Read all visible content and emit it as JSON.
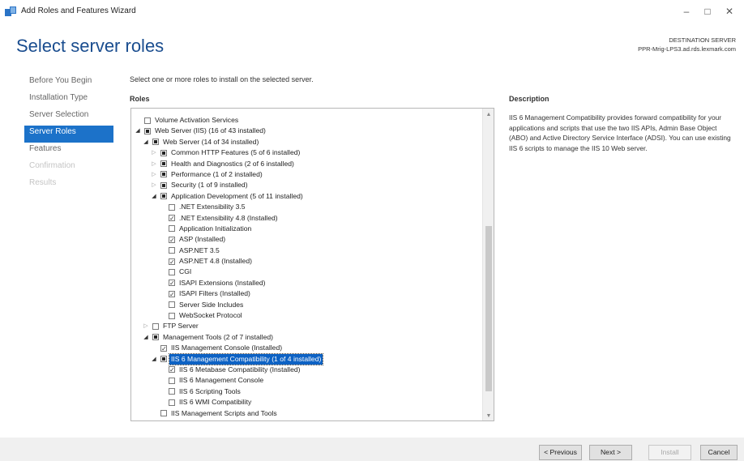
{
  "window": {
    "title": "Add Roles and Features Wizard",
    "minimize": "–",
    "maximize": "□",
    "close": "✕"
  },
  "header": {
    "title": "Select server roles",
    "destination_label": "DESTINATION SERVER",
    "destination_server": "PPR-Mrig-LPS3.ad.rds.lexmark.com"
  },
  "nav": {
    "items": [
      {
        "label": "Before You Begin",
        "state": "normal"
      },
      {
        "label": "Installation Type",
        "state": "normal"
      },
      {
        "label": "Server Selection",
        "state": "normal"
      },
      {
        "label": "Server Roles",
        "state": "active"
      },
      {
        "label": "Features",
        "state": "normal"
      },
      {
        "label": "Confirmation",
        "state": "disabled"
      },
      {
        "label": "Results",
        "state": "disabled"
      }
    ]
  },
  "main": {
    "instruction": "Select one or more roles to install on the selected server.",
    "roles_heading": "Roles",
    "roles": [
      {
        "label": "Volume Activation Services",
        "level": 0,
        "expander": "none",
        "check": "unchecked"
      },
      {
        "label": "Web Server (IIS) (16 of 43 installed)",
        "level": 0,
        "expander": "expanded",
        "check": "partial"
      },
      {
        "label": "Web Server (14 of 34 installed)",
        "level": 1,
        "expander": "expanded",
        "check": "partial"
      },
      {
        "label": "Common HTTP Features (5 of 6 installed)",
        "level": 2,
        "expander": "collapsed",
        "check": "partial"
      },
      {
        "label": "Health and Diagnostics (2 of 6 installed)",
        "level": 2,
        "expander": "collapsed",
        "check": "partial"
      },
      {
        "label": "Performance (1 of 2 installed)",
        "level": 2,
        "expander": "collapsed",
        "check": "partial"
      },
      {
        "label": "Security (1 of 9 installed)",
        "level": 2,
        "expander": "collapsed",
        "check": "partial"
      },
      {
        "label": "Application Development (5 of 11 installed)",
        "level": 2,
        "expander": "expanded",
        "check": "partial"
      },
      {
        "label": ".NET Extensibility 3.5",
        "level": 3,
        "expander": "none",
        "check": "unchecked"
      },
      {
        "label": ".NET Extensibility 4.8 (Installed)",
        "level": 3,
        "expander": "none",
        "check": "checked"
      },
      {
        "label": "Application Initialization",
        "level": 3,
        "expander": "none",
        "check": "unchecked"
      },
      {
        "label": "ASP (Installed)",
        "level": 3,
        "expander": "none",
        "check": "checked"
      },
      {
        "label": "ASP.NET 3.5",
        "level": 3,
        "expander": "none",
        "check": "unchecked"
      },
      {
        "label": "ASP.NET 4.8 (Installed)",
        "level": 3,
        "expander": "none",
        "check": "checked"
      },
      {
        "label": "CGI",
        "level": 3,
        "expander": "none",
        "check": "unchecked"
      },
      {
        "label": "ISAPI Extensions (Installed)",
        "level": 3,
        "expander": "none",
        "check": "checked"
      },
      {
        "label": "ISAPI Filters (Installed)",
        "level": 3,
        "expander": "none",
        "check": "checked"
      },
      {
        "label": "Server Side Includes",
        "level": 3,
        "expander": "none",
        "check": "unchecked"
      },
      {
        "label": "WebSocket Protocol",
        "level": 3,
        "expander": "none",
        "check": "unchecked"
      },
      {
        "label": "FTP Server",
        "level": 1,
        "expander": "collapsed",
        "check": "unchecked"
      },
      {
        "label": "Management Tools (2 of 7 installed)",
        "level": 1,
        "expander": "expanded",
        "check": "partial"
      },
      {
        "label": "IIS Management Console (Installed)",
        "level": 2,
        "expander": "none",
        "check": "checked"
      },
      {
        "label": "IIS 6 Management Compatibility (1 of 4 installed)",
        "level": 2,
        "expander": "expanded",
        "check": "partial",
        "selected": true
      },
      {
        "label": "IIS 6 Metabase Compatibility (Installed)",
        "level": 3,
        "expander": "none",
        "check": "checked"
      },
      {
        "label": "IIS 6 Management Console",
        "level": 3,
        "expander": "none",
        "check": "unchecked"
      },
      {
        "label": "IIS 6 Scripting Tools",
        "level": 3,
        "expander": "none",
        "check": "unchecked"
      },
      {
        "label": "IIS 6 WMI Compatibility",
        "level": 3,
        "expander": "none",
        "check": "unchecked"
      },
      {
        "label": "IIS Management Scripts and Tools",
        "level": 2,
        "expander": "none",
        "check": "unchecked"
      }
    ],
    "scroll_up": "▲",
    "scroll_down": "▼"
  },
  "description": {
    "heading": "Description",
    "text": "IIS 6 Management Compatibility provides forward compatibility for your applications and scripts that use the two IIS APIs, Admin Base Object (ABO) and Active Directory Service Interface (ADSI). You can use existing IIS 6 scripts to manage the IIS 10 Web server."
  },
  "footer": {
    "previous": "< Previous",
    "next": "Next >",
    "install": "Install",
    "cancel": "Cancel"
  }
}
